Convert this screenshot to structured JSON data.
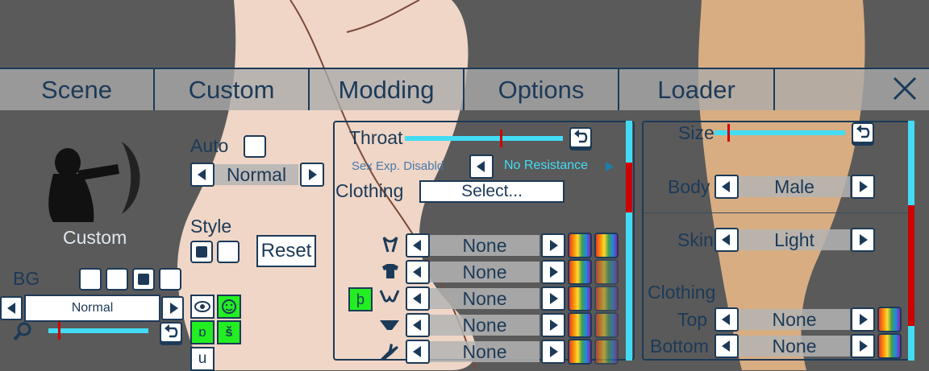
{
  "menu": {
    "tabs": [
      "Scene",
      "Custom",
      "Modding",
      "Options",
      "Loader"
    ]
  },
  "left": {
    "preset_label": "Custom",
    "auto_label": "Auto",
    "auto_select": "Normal",
    "style_label": "Style",
    "reset_label": "Reset",
    "bg_label": "BG",
    "bg_select": "Normal",
    "small_buttons": [
      "ɒ",
      "š",
      "u"
    ]
  },
  "middle": {
    "throat_label": "Throat",
    "throat_level": 0.6,
    "sexexp_label": "Sex Exp. Disabld",
    "resistance_select": "No Resistance",
    "clothing_label": "Clothing",
    "select_button": "Select...",
    "tag_button": "þ",
    "rows": [
      {
        "icon": "collar-icon",
        "value": "None"
      },
      {
        "icon": "shirt-icon",
        "value": "None"
      },
      {
        "icon": "bra-icon",
        "value": "None"
      },
      {
        "icon": "panties-icon",
        "value": "None"
      },
      {
        "icon": "glove-icon",
        "value": "None"
      }
    ]
  },
  "right": {
    "size_label": "Size",
    "size_level": 0.1,
    "body_label": "Body",
    "body_value": "Male",
    "skin_label": "Skin",
    "skin_value": "Light",
    "clothing_label": "Clothing",
    "top_label": "Top",
    "top_value": "None",
    "bottom_label": "Bottom",
    "bottom_value": "None"
  },
  "colors": {
    "accent": "#1c3a58",
    "scroll": "#43dcf5",
    "thumb": "#cc0000",
    "green": "#22ee22"
  }
}
